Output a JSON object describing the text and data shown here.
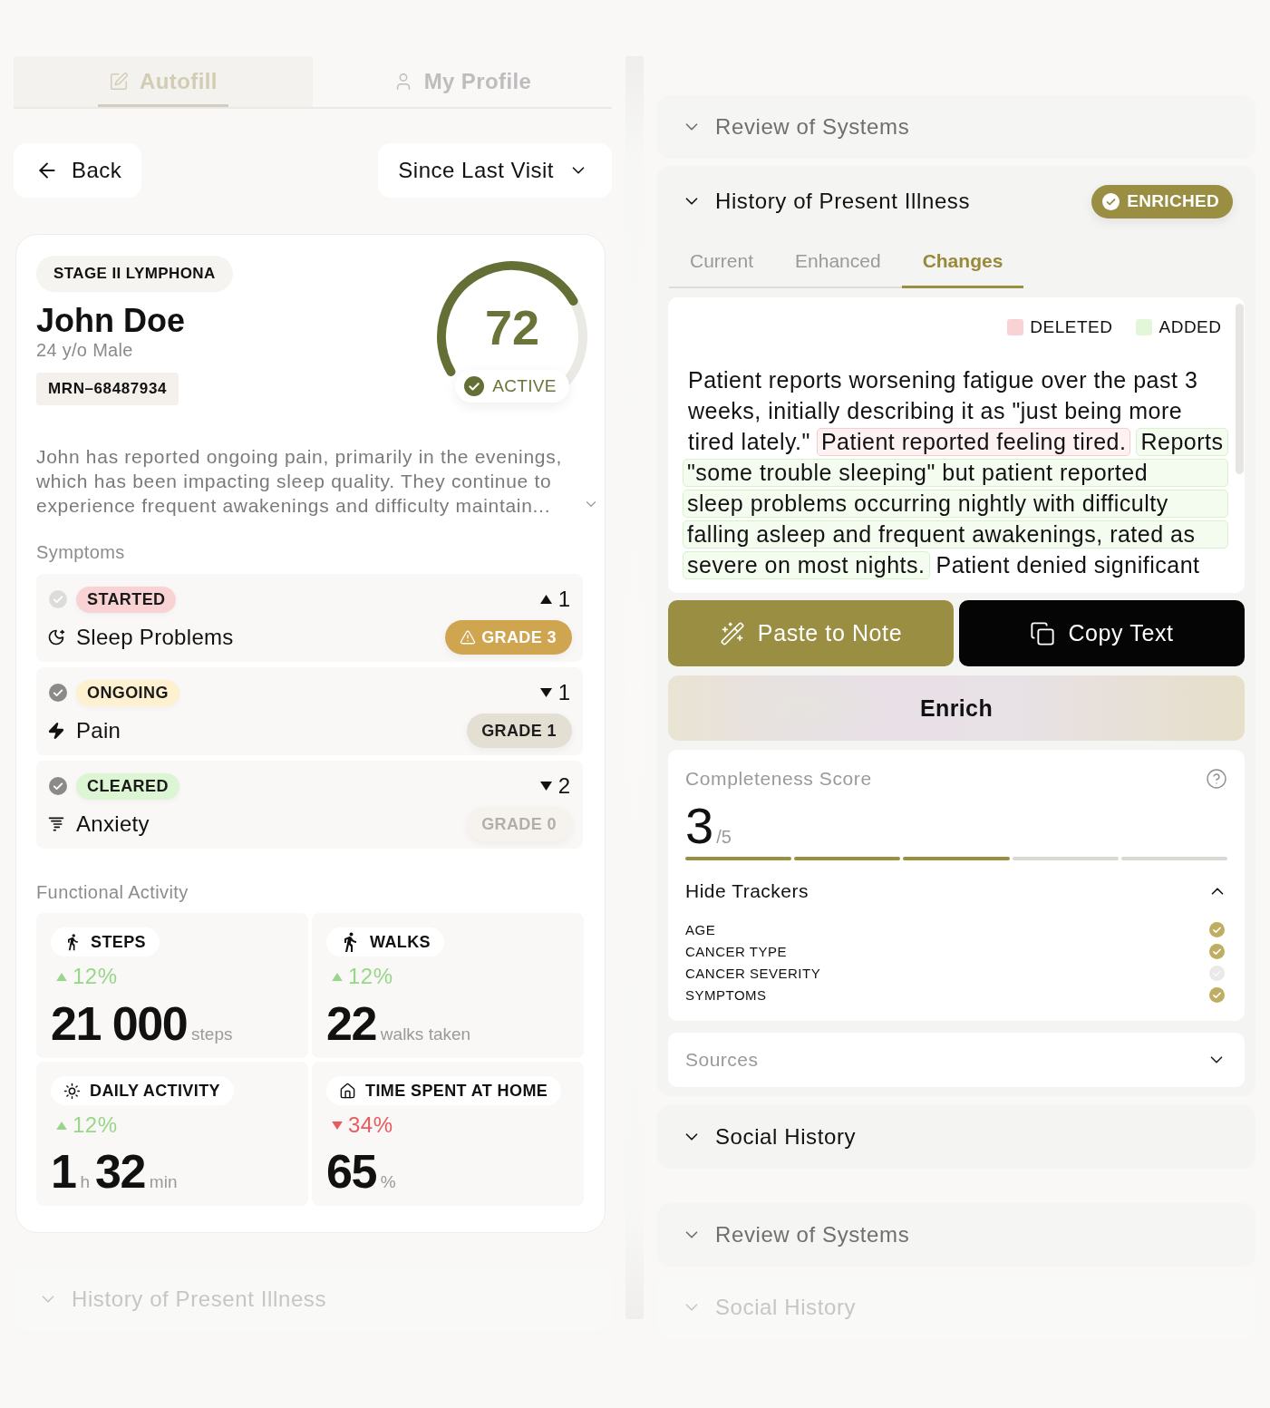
{
  "left_tabs": [
    {
      "label": "Autofill",
      "selected": true
    },
    {
      "label": "My Profile",
      "selected": false
    }
  ],
  "back_button": {
    "label": "Back"
  },
  "period_select": {
    "value": "Since Last Visit"
  },
  "patient": {
    "diagnosis": "STAGE II LYMPHONA",
    "name": "John Doe",
    "demographics": "24 y/o Male",
    "mrn": "MRN–68487934",
    "score": {
      "value": "72",
      "status": "ACTIVE"
    },
    "summary": "John has reported ongoing pain, primarily in the evenings, which has been impacting sleep quality. They continue to experience frequent awakenings and difficulty maintain..."
  },
  "symptoms": {
    "title": "Symptoms",
    "items": [
      {
        "checked": false,
        "status": {
          "label": "STARTED",
          "color": "#f9d3d3"
        },
        "trend": {
          "up": true,
          "value": "1"
        },
        "name": "Sleep Problems",
        "grade": {
          "label": "GRADE 3",
          "kind": "severe"
        }
      },
      {
        "checked": true,
        "status": {
          "label": "ONGOING",
          "color": "#fdf1cf"
        },
        "trend": {
          "up": false,
          "value": "1"
        },
        "name": "Pain",
        "grade": {
          "label": "GRADE 1",
          "kind": "mild"
        }
      },
      {
        "checked": true,
        "status": {
          "label": "CLEARED",
          "color": "#dcf5d3"
        },
        "trend": {
          "up": false,
          "value": "2"
        },
        "name": "Anxiety",
        "grade": {
          "label": "GRADE 0",
          "kind": "none"
        }
      }
    ]
  },
  "functional_activity": {
    "title": "Functional Activity",
    "tiles": [
      {
        "label": "STEPS",
        "change": {
          "up": true,
          "value": "12%"
        },
        "value": [
          {
            "number": "21 000",
            "unit": "steps"
          }
        ]
      },
      {
        "label": "WALKS",
        "change": {
          "up": true,
          "value": "12%"
        },
        "value": [
          {
            "number": "22",
            "unit": "walks taken"
          }
        ]
      },
      {
        "label": "DAILY ACTIVITY",
        "change": {
          "up": true,
          "value": "12%"
        },
        "value": [
          {
            "number": "1",
            "unit": "h"
          },
          {
            "number": "32",
            "unit": "min"
          }
        ]
      },
      {
        "label": "TIME SPENT AT HOME",
        "change": {
          "up": false,
          "value": "34%"
        },
        "value": [
          {
            "number": "65",
            "unit": "%"
          }
        ]
      }
    ]
  },
  "left_sections": [
    {
      "title": "History of Present Illness",
      "expanded": false,
      "kind": "faint"
    }
  ],
  "right_sections": [
    {
      "title": "Review of Systems",
      "expanded": false,
      "kind": "muted"
    },
    {
      "title": "History of Present Illness",
      "expanded": true,
      "kind": "normal",
      "badge": "ENRICHED",
      "tabs": [
        {
          "label": "Current",
          "selected": false
        },
        {
          "label": "Enhanced",
          "selected": false
        },
        {
          "label": "Changes",
          "selected": true
        }
      ],
      "legend": [
        {
          "label": "DELETED",
          "color": "#f9d3d3"
        },
        {
          "label": "ADDED",
          "color": "#e2f6d9"
        }
      ],
      "diff_lines": [
        [
          {
            "kind": "plain",
            "text": "Patient reports worsening fatigue over the past 3"
          }
        ],
        [
          {
            "kind": "plain",
            "text": "weeks, initially describing it as \"just being more"
          }
        ],
        [
          {
            "kind": "plain",
            "text": "tired lately.\""
          },
          {
            "kind": "deleted",
            "text": "Patient reported feeling tired."
          },
          {
            "kind": "added",
            "text": "Reports"
          }
        ],
        [
          {
            "kind": "added",
            "text": "\"some trouble sleeping\" but patient reported"
          }
        ],
        [
          {
            "kind": "added",
            "text": "sleep problems occurring nightly with difficulty"
          }
        ],
        [
          {
            "kind": "added",
            "text": "falling asleep and frequent awakenings, rated as"
          }
        ],
        [
          {
            "kind": "added",
            "text": "severe on most nights."
          },
          {
            "kind": "plain",
            "text": "Patient denied significant"
          }
        ]
      ],
      "actions": [
        {
          "label": "Paste to Note",
          "kind": "primary"
        },
        {
          "label": "Copy Text",
          "kind": "dark"
        }
      ],
      "enrich_button": {
        "label": "Enrich"
      },
      "completeness": {
        "title": "Completeness Score",
        "score": "3",
        "max": "/5",
        "segments": [
          {
            "filled": true
          },
          {
            "filled": true
          },
          {
            "filled": true
          },
          {
            "filled": false
          },
          {
            "filled": false
          }
        ],
        "trackers_toggle": "Hide Trackers",
        "trackers_expanded": true,
        "trackers": [
          {
            "label": "AGE",
            "checked": true
          },
          {
            "label": "CANCER TYPE",
            "checked": true
          },
          {
            "label": "CANCER SEVERITY",
            "checked": false
          },
          {
            "label": "SYMPTOMS",
            "checked": true
          }
        ]
      },
      "sources": {
        "title": "Sources",
        "expanded": false
      }
    },
    {
      "title": "Social History",
      "expanded": false,
      "kind": "normal"
    },
    {
      "title": "Review of Systems",
      "expanded": false,
      "kind": "muted"
    },
    {
      "title": "Social History",
      "expanded": false,
      "kind": "faint"
    }
  ]
}
